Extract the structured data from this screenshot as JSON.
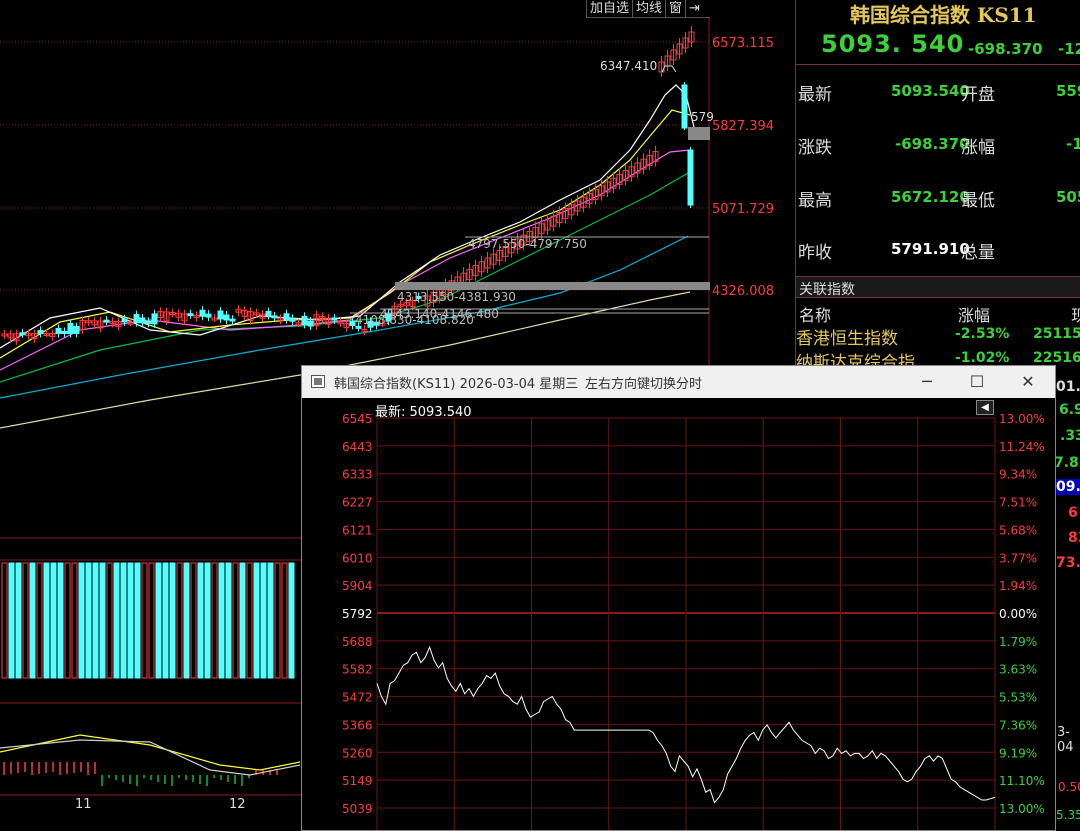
{
  "toolbar": {
    "add_self": "加自选",
    "ma_line": "均线",
    "window": "窗",
    "pin": "⇥"
  },
  "main_chart": {
    "y_labels": [
      "6573.115",
      "5827.394",
      "5071.729",
      "4326.008"
    ],
    "peak_label": "6347.410",
    "cut_label": "579",
    "range_labels": [
      "4797.550-4797.750",
      "4313.550-4381.930",
      "4143.140-4146.480",
      "4108.830-4108.820"
    ],
    "date_labels": [
      "11",
      "12"
    ],
    "colors": {
      "up": "#ff3a3a",
      "down": "#54ffff",
      "ma5": "#ffffff",
      "ma10": "#ffff33",
      "ma20": "#ff66ff",
      "ma60": "#00c040",
      "ma120": "#00b4d8",
      "ma250": "#dcdca0",
      "grid": "#8a1e1e"
    }
  },
  "quote": {
    "title": "韩国综合指数 KS11",
    "price": "5093. 540",
    "change": "-698.370",
    "change_pct": "-12.",
    "rows": [
      {
        "label": "最新",
        "value": "5093.540",
        "label2": "开盘",
        "value2": "559",
        "color": "#3bd13b",
        "color2": "#3bd13b"
      },
      {
        "label": "涨跌",
        "value": "-698.370",
        "label2": "涨幅",
        "value2": "-1",
        "color": "#3bd13b",
        "color2": "#3bd13b"
      },
      {
        "label": "最高",
        "value": "5672.120",
        "label2": "最低",
        "value2": "505",
        "color": "#3bd13b",
        "color2": "#3bd13b"
      },
      {
        "label": "昨收",
        "value": "5791.910",
        "label2": "总量",
        "value2": "",
        "color": "#ffffff",
        "color2": "#ffffff"
      }
    ],
    "related_header": "关联指数",
    "related_cols": {
      "name": "名称",
      "change": "涨幅",
      "price": "现"
    },
    "related": [
      {
        "name": "香港恒生指数",
        "change": "-2.53%",
        "price": "25115."
      },
      {
        "name": "纳斯达克综合指...",
        "change": "-1.02%",
        "price": "22516."
      }
    ]
  },
  "right_partial": {
    "values": [
      "01.",
      "6.9",
      ".33",
      "7.81",
      "09.0",
      "6",
      "83",
      "73.5"
    ],
    "date_frag": "3-04",
    "bottom_frags": [
      "0.50%",
      "5.35%"
    ]
  },
  "popup": {
    "title": "韩国综合指数(KS11) 2026-03-04 星期三",
    "hint": "左右方向键切换分时",
    "minimize": "─",
    "maximize": "☐",
    "close": "✕",
    "latest_label": "最新: 5093.540",
    "back_icon": "◀",
    "y_left": [
      "6545",
      "6443",
      "6333",
      "6227",
      "6121",
      "6010",
      "5904",
      "5792",
      "5688",
      "5582",
      "5472",
      "5366",
      "5260",
      "5149",
      "5039"
    ],
    "y_right": [
      "13.00%",
      "11.24%",
      "9.34%",
      "7.51%",
      "5.68%",
      "3.77%",
      "1.94%",
      "0.00%",
      "1.79%",
      "3.63%",
      "5.53%",
      "7.36%",
      "9.19%",
      "11.10%",
      "13.00%"
    ],
    "prev_close": "5792",
    "chart_data": {
      "type": "line",
      "title": "",
      "xlabel": "",
      "ylabel": "",
      "ylim": [
        5039,
        6545
      ],
      "reference": 5792,
      "series": [
        {
          "values": [
            5520,
            5470,
            5440,
            5520,
            5530,
            5560,
            5590,
            5600,
            5630,
            5640,
            5600,
            5620,
            5660,
            5610,
            5580,
            5600,
            5540,
            5510,
            5490,
            5520,
            5480,
            5500,
            5470,
            5500,
            5520,
            5550,
            5540,
            5560,
            5510,
            5480,
            5470,
            5450,
            5440,
            5470,
            5420,
            5390,
            5400,
            5410,
            5450,
            5460,
            5470,
            5440,
            5420,
            5380,
            5370,
            5340,
            5340,
            5340,
            5340,
            5340,
            5340,
            5340,
            5340,
            5340,
            5340,
            5340,
            5340,
            5340,
            5340,
            5340,
            5340,
            5340,
            5340,
            5330,
            5300,
            5280,
            5250,
            5200,
            5180,
            5240,
            5220,
            5200,
            5160,
            5190,
            5150,
            5100,
            5110,
            5060,
            5080,
            5110,
            5170,
            5200,
            5230,
            5270,
            5300,
            5320,
            5330,
            5300,
            5340,
            5360,
            5330,
            5310,
            5330,
            5350,
            5370,
            5340,
            5320,
            5300,
            5290,
            5280,
            5250,
            5270,
            5260,
            5230,
            5240,
            5270,
            5250,
            5260,
            5240,
            5250,
            5250,
            5230,
            5240,
            5260,
            5230,
            5250,
            5240,
            5220,
            5200,
            5180,
            5150,
            5140,
            5150,
            5180,
            5200,
            5230,
            5240,
            5220,
            5240,
            5230,
            5190,
            5150,
            5140,
            5120,
            5110,
            5100,
            5090,
            5080,
            5070,
            5070,
            5075,
            5080
          ]
        }
      ]
    }
  }
}
